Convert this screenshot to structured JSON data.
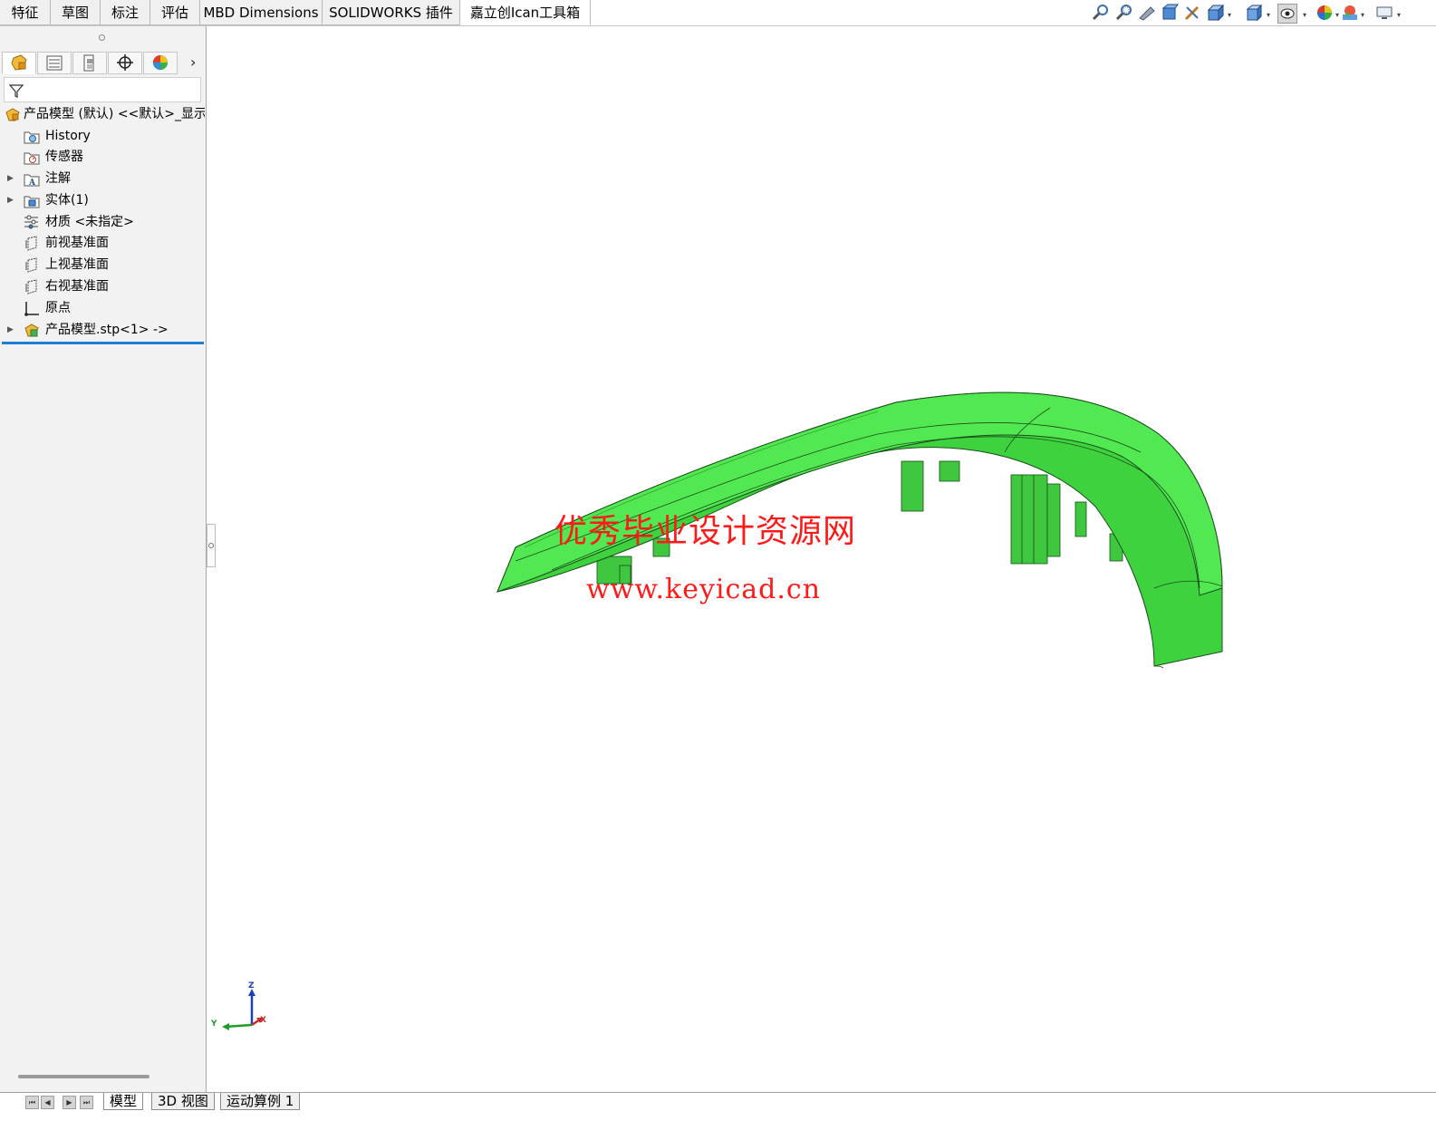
{
  "command_tabs": [
    {
      "label": "特征",
      "active": false
    },
    {
      "label": "草图",
      "active": false
    },
    {
      "label": "标注",
      "active": false
    },
    {
      "label": "评估",
      "active": false
    },
    {
      "label": "MBD Dimensions",
      "active": false
    },
    {
      "label": "SOLIDWORKS 插件",
      "active": false
    },
    {
      "label": "嘉立创Ican工具箱",
      "active": true
    }
  ],
  "view_toolbar": {
    "icons": [
      "zoom-to-fit-icon",
      "zoom-to-area-icon",
      "previous-view-icon",
      "section-view-icon",
      "dynamic-annotation-icon",
      "view-orientation-icon",
      "display-style-icon",
      "hide-show-items-icon",
      "edit-appearance-icon",
      "apply-scene-icon",
      "view-settings-icon"
    ]
  },
  "feature_tree": {
    "root_label": "产品模型 (默认) <<默认>_显示",
    "items": [
      {
        "label": "History",
        "icon": "history-folder-icon",
        "expandable": false
      },
      {
        "label": "传感器",
        "icon": "sensors-folder-icon",
        "expandable": false
      },
      {
        "label": "注解",
        "icon": "annotations-folder-icon",
        "expandable": true
      },
      {
        "label": "实体(1)",
        "icon": "solid-bodies-folder-icon",
        "expandable": true
      },
      {
        "label": "材质 <未指定>",
        "icon": "material-icon",
        "expandable": false
      },
      {
        "label": "前视基准面",
        "icon": "plane-icon",
        "expandable": false
      },
      {
        "label": "上视基准面",
        "icon": "plane-icon",
        "expandable": false
      },
      {
        "label": "右视基准面",
        "icon": "plane-icon",
        "expandable": false
      },
      {
        "label": "原点",
        "icon": "origin-icon",
        "expandable": false
      },
      {
        "label": "产品模型.stp<1> ->",
        "icon": "imported-feature-icon",
        "expandable": true
      }
    ]
  },
  "watermark": {
    "line1": "优秀毕业设计资源网",
    "line2": "www.keyicad.cn"
  },
  "triad": {
    "z": "Z",
    "y": "Y",
    "x": "X"
  },
  "bottom_tabs": [
    {
      "label": "模型",
      "active": true
    },
    {
      "label": "3D 视图",
      "active": false
    },
    {
      "label": "运动算例 1",
      "active": false
    }
  ],
  "colors": {
    "model_green": "#45e045",
    "watermark_red": "#ff1a1a",
    "selection_blue": "#1c7ed6"
  }
}
